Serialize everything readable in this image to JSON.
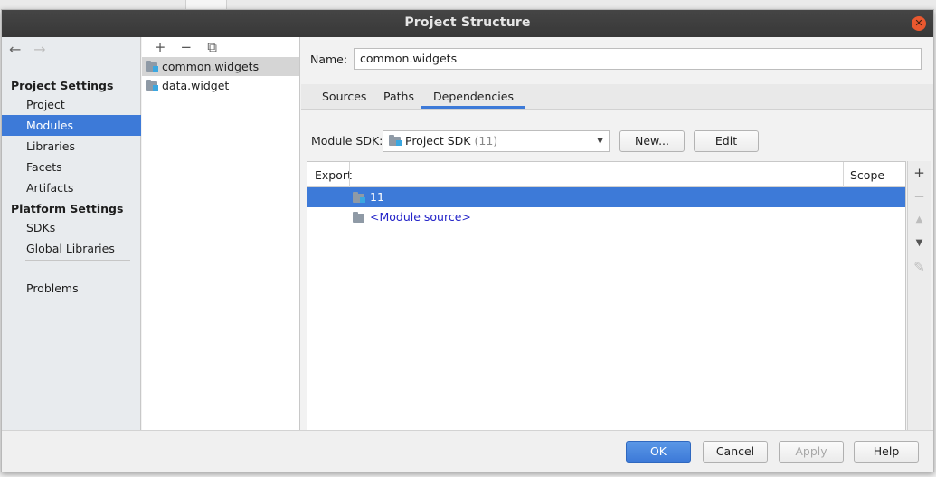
{
  "window": {
    "title": "Project Structure"
  },
  "nav": {
    "back": "←",
    "forward": "→",
    "group_project": "Project Settings",
    "group_platform": "Platform Settings",
    "items_project": [
      "Project",
      "Modules",
      "Libraries",
      "Facets",
      "Artifacts"
    ],
    "items_platform": [
      "SDKs",
      "Global Libraries"
    ],
    "problems": "Problems",
    "selected": "Modules"
  },
  "modules": {
    "toolbar": {
      "add": "+",
      "remove": "−",
      "copy": "⧉"
    },
    "items": [
      "common.widgets",
      "data.widget"
    ],
    "selected": "common.widgets"
  },
  "panel": {
    "name_label": "Name:",
    "name_value": "common.widgets",
    "tabs": [
      "Sources",
      "Paths",
      "Dependencies"
    ],
    "active_tab": "Dependencies",
    "sdk_label": "Module SDK:",
    "sdk_value": "Project SDK",
    "sdk_version": "(11)",
    "new_button": "New...",
    "edit_button": "Edit",
    "table": {
      "col_export": "Export",
      "col_scope": "Scope",
      "rows": [
        "11",
        "<Module source>"
      ]
    },
    "side_tools": [
      "+",
      "−",
      "▲",
      "▼",
      "✎"
    ]
  },
  "footer": {
    "ok": "OK",
    "cancel": "Cancel",
    "apply": "Apply",
    "help": "Help"
  },
  "colors": {
    "accent": "#3d7ad8",
    "title_bar": "#3c3c3c",
    "close": "#e9582f"
  }
}
